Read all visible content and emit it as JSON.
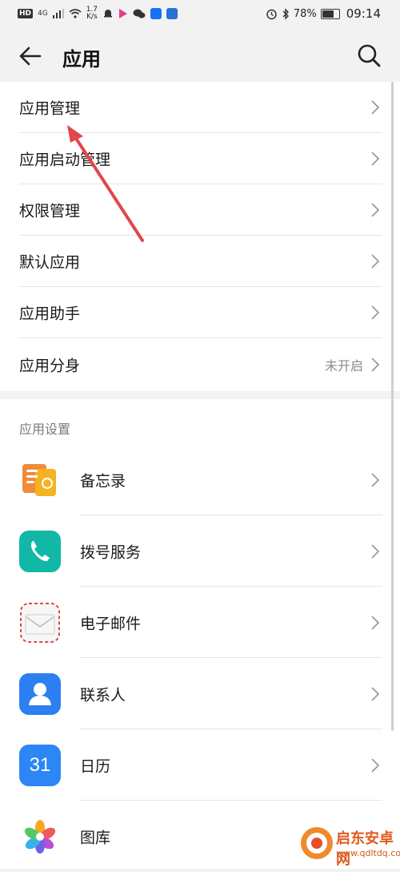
{
  "status_bar": {
    "hd": "HD",
    "net": "4G",
    "speed_value": "1.7",
    "speed_unit": "K/s",
    "battery": "78%",
    "time": "09:14",
    "battery_level": 0.78
  },
  "header": {
    "title": "应用",
    "back_icon": "arrow-left-icon",
    "search_icon": "search-icon"
  },
  "menu": [
    {
      "label": "应用管理",
      "value": ""
    },
    {
      "label": "应用启动管理",
      "value": ""
    },
    {
      "label": "权限管理",
      "value": ""
    },
    {
      "label": "默认应用",
      "value": ""
    },
    {
      "label": "应用助手",
      "value": ""
    },
    {
      "label": "应用分身",
      "value": "未开启"
    }
  ],
  "section": {
    "title": "应用设置",
    "apps": [
      {
        "label": "备忘录",
        "icon": "notes-icon"
      },
      {
        "label": "拨号服务",
        "icon": "phone-icon"
      },
      {
        "label": "电子邮件",
        "icon": "email-icon"
      },
      {
        "label": "联系人",
        "icon": "contacts-icon"
      },
      {
        "label": "日历",
        "icon": "calendar-icon",
        "icon_text": "31"
      },
      {
        "label": "图库",
        "icon": "gallery-icon"
      }
    ]
  },
  "watermark": {
    "line1": "启东安卓网",
    "line2": "www.qdltdq.com"
  },
  "colors": {
    "accent_red": "#e0474c",
    "phone_teal": "#11b8a5",
    "contacts_blue": "#2b7ff0",
    "calendar_blue": "#2d86f5",
    "notes_orange": "#f5a623"
  }
}
